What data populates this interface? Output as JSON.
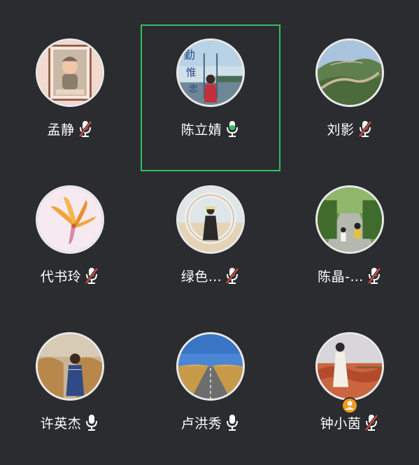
{
  "participants": [
    {
      "name": "孟静",
      "mic": "muted",
      "avatar_icon": "baby-photo-icon",
      "active": false
    },
    {
      "name": "陈立婧",
      "mic": "speaking",
      "avatar_icon": "woman-calligraphy-photo-icon",
      "active": true
    },
    {
      "name": "刘影",
      "mic": "muted",
      "avatar_icon": "great-wall-photo-icon",
      "active": false
    },
    {
      "name": "代书玲",
      "mic": "muted",
      "avatar_icon": "flower-photo-icon",
      "active": false
    },
    {
      "name": "绿色…",
      "mic": "muted",
      "avatar_icon": "beach-ring-photo-icon",
      "active": false
    },
    {
      "name": "陈晶-…",
      "mic": "muted",
      "avatar_icon": "park-road-photo-icon",
      "active": false
    },
    {
      "name": "许英杰",
      "mic": "on",
      "avatar_icon": "woman-field-photo-icon",
      "active": false
    },
    {
      "name": "卢洪秀",
      "mic": "on",
      "avatar_icon": "desert-road-photo-icon",
      "active": false
    },
    {
      "name": "钟小茵",
      "mic": "muted",
      "avatar_icon": "woman-redrock-photo-icon",
      "active": false,
      "host_badge_icon": "host-person-icon"
    }
  ],
  "colors": {
    "background": "#2b2c2f",
    "active_border": "#2fbf62",
    "speaking_mic": "#2fbf62",
    "muted_slash": "#e5493f",
    "host_badge": "#f39a1c"
  }
}
